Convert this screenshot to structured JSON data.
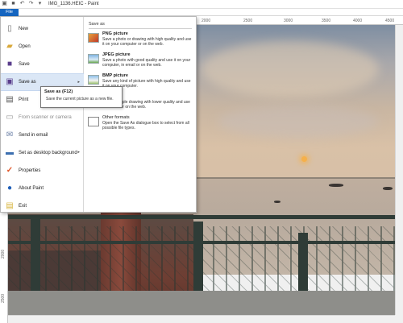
{
  "window": {
    "title": "IMG_1136.HEIC - Paint"
  },
  "ribbon": {
    "file_tab": "File"
  },
  "ruler": {
    "top_ticks": [
      "2000",
      "2500",
      "3000",
      "3500",
      "4000",
      "4500"
    ],
    "left_ticks": [
      "2000",
      "2500"
    ]
  },
  "file_menu": {
    "items": [
      {
        "label": "New",
        "icon": "new-file-icon"
      },
      {
        "label": "Open",
        "icon": "open-folder-icon"
      },
      {
        "label": "Save",
        "icon": "save-disk-icon"
      },
      {
        "label": "Save as",
        "icon": "save-as-icon",
        "submenu_arrow": "▸"
      },
      {
        "label": "Print",
        "icon": "printer-icon",
        "submenu_arrow": "▸"
      },
      {
        "label": "From scanner or camera",
        "icon": "scanner-icon"
      },
      {
        "label": "Send in email",
        "icon": "email-icon"
      },
      {
        "label": "Set as desktop background",
        "icon": "desktop-icon",
        "submenu_arrow": "▸"
      },
      {
        "label": "Properties",
        "icon": "checkmark-icon"
      },
      {
        "label": "About Paint",
        "icon": "info-icon"
      },
      {
        "label": "Exit",
        "icon": "exit-icon"
      }
    ]
  },
  "save_as_panel": {
    "heading": "Save as",
    "options": [
      {
        "title": "PNG picture",
        "description": "Save a photo or drawing with high quality and use it on your computer or on the web."
      },
      {
        "title": "JPEG picture",
        "description": "Save a photo with good quality and use it on your computer, in email or on the web."
      },
      {
        "title": "BMP picture",
        "description": "Save any kind of picture with high quality and use it on your computer."
      },
      {
        "title": "",
        "description": "Save a simple drawing with lower quality and use it in email or on the web."
      },
      {
        "title": "Other formats",
        "description": "Open the Save As dialogue box to select from all possible file types."
      }
    ]
  },
  "tooltip": {
    "title": "Save as (F12)",
    "description": "Save the current picture as a new file."
  },
  "colors": {
    "file_tab": "#1565c0",
    "menu_hover": "#dbe7f6"
  }
}
